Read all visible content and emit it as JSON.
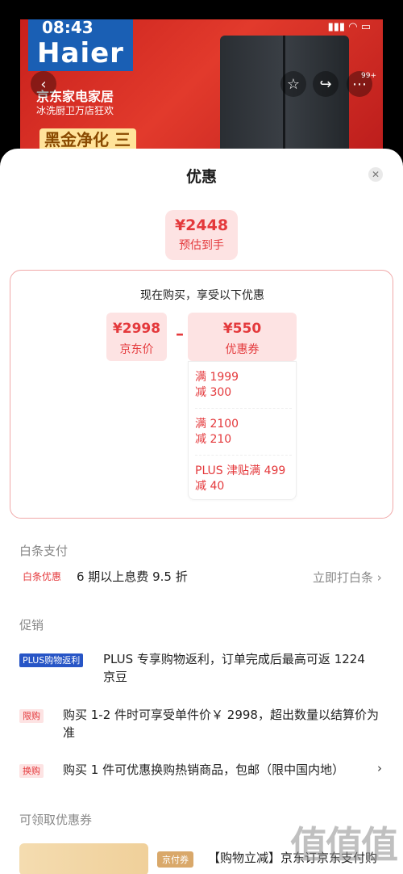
{
  "status": {
    "time": "08:43"
  },
  "banner": {
    "brand": "Haier",
    "promo_title": "京东家电家居",
    "promo_sub": "冰洗厨卫万店狂欢",
    "promo_big": "黑金净化 三档变温",
    "badge": "99+",
    "icons": [
      "back-icon",
      "star-icon",
      "share-icon",
      "more-icon"
    ]
  },
  "sheet": {
    "title": "优惠",
    "estimate": {
      "price": "¥2448",
      "label": "预估到手"
    },
    "calc": {
      "heading": "现在购买，享受以下优惠",
      "jd_price": {
        "value": "¥2998",
        "label": "京东价"
      },
      "minus": "–",
      "coupon": {
        "value": "¥550",
        "label": "优惠券"
      },
      "coupons": [
        {
          "line1": "满 1999",
          "line2": "减 300"
        },
        {
          "line1": "满 2100",
          "line2": "减 210"
        },
        {
          "line1": "PLUS 津贴满 499",
          "line2": "减 40"
        }
      ]
    },
    "baitiao": {
      "title": "白条支付",
      "tag": "白条优惠",
      "text": "6 期以上息费 9.5 折",
      "link": "立即打白条 ›"
    },
    "promo": {
      "title": "促销",
      "items": [
        {
          "tag": "PLUS购物返利",
          "text": "PLUS 专享购物返利，订单完成后最高可返 1224 京豆"
        },
        {
          "tag": "限购",
          "text": "购买 1-2 件时可享受单件价￥ 2998，超出数量以结算价为准"
        },
        {
          "tag": "换购",
          "text": "购买 1 件可优惠换购热销商品，包邮（限中国内地）",
          "arrow": "›"
        }
      ]
    },
    "coupons_section": {
      "title": "可领取优惠券",
      "jt_tag": "京付券",
      "desc": "【购物立减】京东订京东支付购"
    }
  },
  "watermark": "值值值"
}
